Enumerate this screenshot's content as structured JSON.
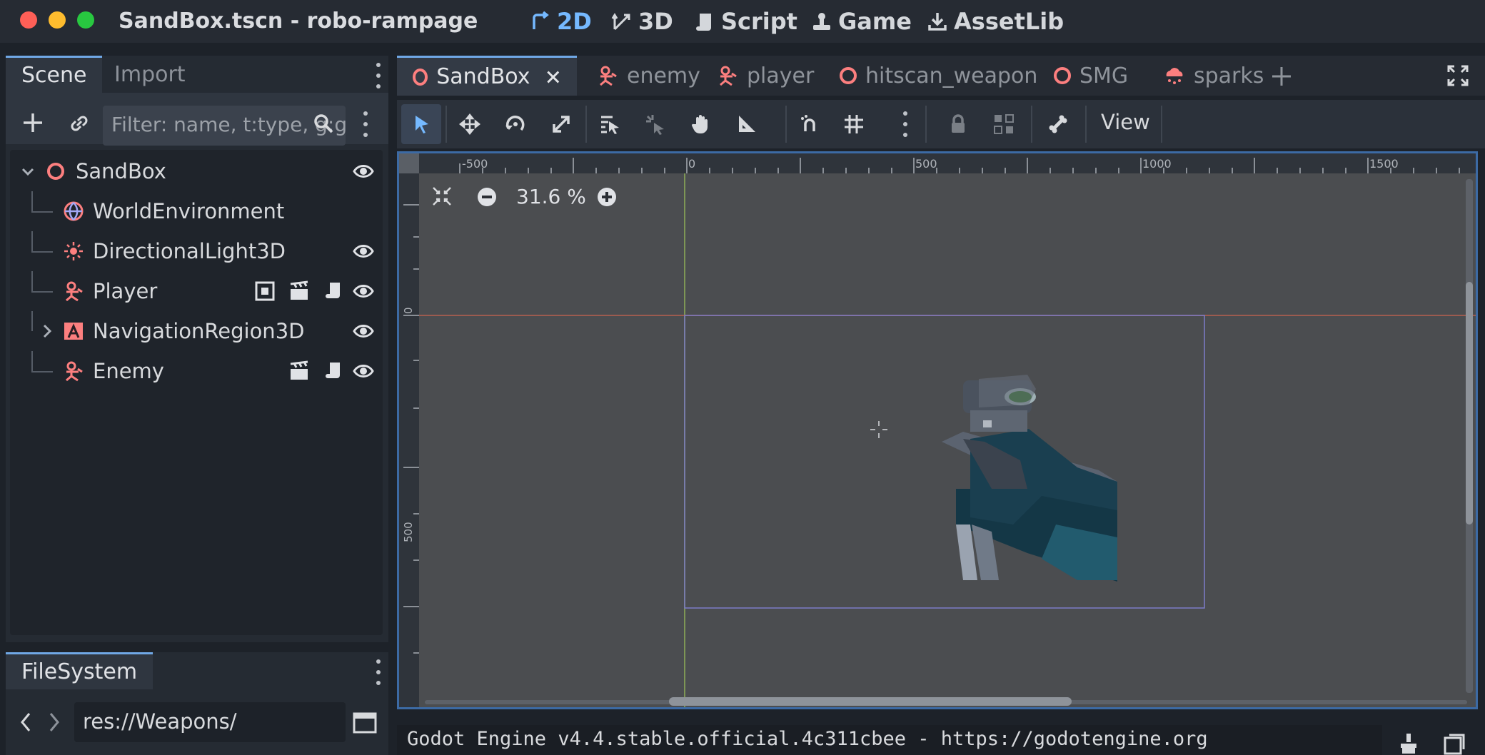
{
  "window": {
    "title": "SandBox.tscn - robo-rampage"
  },
  "main_screens": [
    {
      "label": "2D",
      "icon": "2d-icon",
      "active": true
    },
    {
      "label": "3D",
      "icon": "3d-icon",
      "active": false
    },
    {
      "label": "Script",
      "icon": "script-icon",
      "active": false
    },
    {
      "label": "Game",
      "icon": "game-icon",
      "active": false
    },
    {
      "label": "AssetLib",
      "icon": "download-icon",
      "active": false
    }
  ],
  "scene_dock": {
    "tabs": [
      "Scene",
      "Import"
    ],
    "filter_placeholder": "Filter: name, t:type, g:group",
    "nodes": [
      {
        "name": "SandBox",
        "icon": "node3d-icon",
        "level": 0,
        "expanded": true
      },
      {
        "name": "WorldEnvironment",
        "icon": "world-environment-icon",
        "level": 1
      },
      {
        "name": "DirectionalLight3D",
        "icon": "light-icon",
        "level": 1
      },
      {
        "name": "Player",
        "icon": "character-icon",
        "level": 1
      },
      {
        "name": "NavigationRegion3D",
        "icon": "navigation-region-icon",
        "level": 1,
        "collapsed": true
      },
      {
        "name": "Enemy",
        "icon": "character-icon",
        "level": 1
      }
    ]
  },
  "filesystem_dock": {
    "tab": "FileSystem",
    "path": "res://Weapons/"
  },
  "scene_tabs": [
    {
      "label": "SandBox",
      "icon": "node3d-icon",
      "active": true
    },
    {
      "label": "enemy",
      "icon": "character-icon"
    },
    {
      "label": "player",
      "icon": "character-icon"
    },
    {
      "label": "hitscan_weapon",
      "icon": "node3d-icon"
    },
    {
      "label": "SMG",
      "icon": "node3d-icon"
    },
    {
      "label": "sparks",
      "icon": "particles-icon"
    }
  ],
  "toolbar": {
    "view_label": "View"
  },
  "viewport": {
    "zoom": "31.6 %",
    "ruler_h_labels": [
      "-500",
      "0",
      "500",
      "1000",
      "1500"
    ],
    "ruler_v_labels": [
      "0",
      "500"
    ]
  },
  "status": {
    "text": "Godot Engine v4.4.stable.official.4c311cbee - https://godotengine.org"
  },
  "colors": {
    "accent": "#70a8e6",
    "node3d": "#fc7f7f",
    "viewport_bg": "#4b4d50",
    "panel": "#252b33"
  }
}
